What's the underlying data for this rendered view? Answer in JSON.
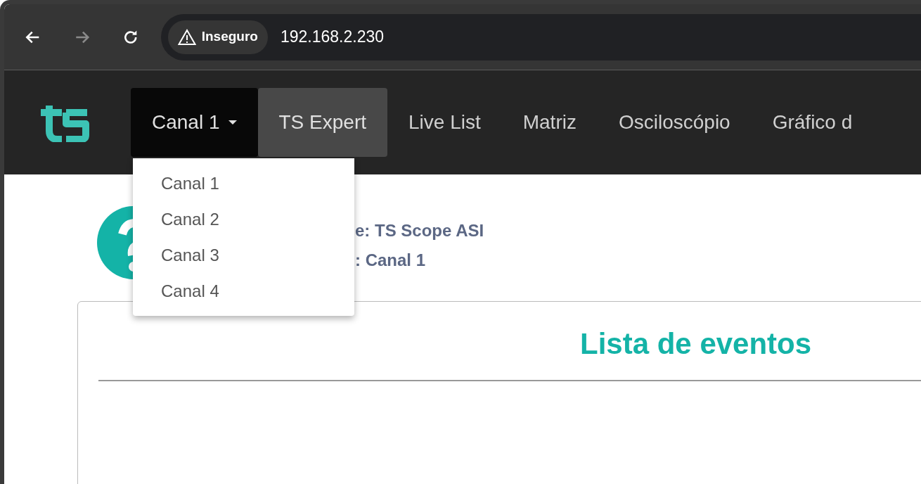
{
  "browser": {
    "security_label": "Inseguro",
    "address": "192.168.2.230"
  },
  "nav": {
    "items": [
      {
        "label": "Canal 1",
        "kind": "dropdown",
        "expanded": true,
        "active": false
      },
      {
        "label": "TS Expert",
        "kind": "link",
        "active": true
      },
      {
        "label": "Live List",
        "kind": "link",
        "active": false
      },
      {
        "label": "Matriz",
        "kind": "link",
        "active": false
      },
      {
        "label": "Osciloscópio",
        "kind": "link",
        "active": false
      },
      {
        "label": "Gráfico d",
        "kind": "link",
        "active": false
      }
    ]
  },
  "dropdown": {
    "items": [
      "Canal 1",
      "Canal 2",
      "Canal 3",
      "Canal 4"
    ]
  },
  "device_info": {
    "lines": [
      "e: TS Scope ASI",
      ": Canal 1"
    ]
  },
  "card": {
    "title": "Lista de eventos"
  }
}
